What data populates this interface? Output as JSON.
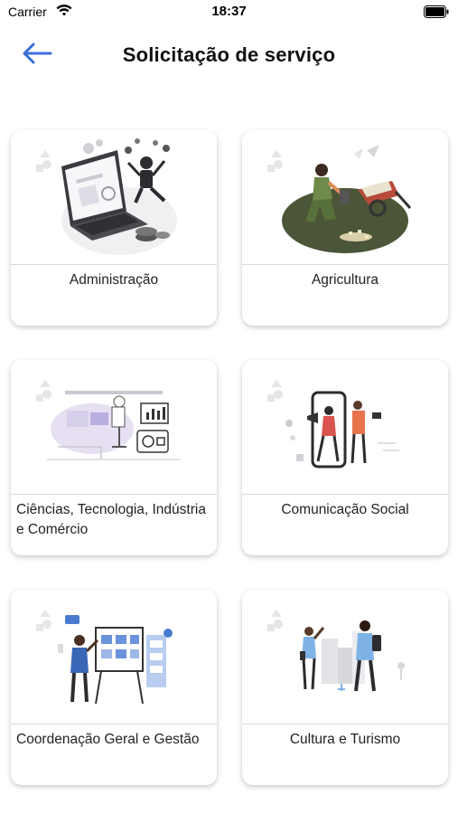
{
  "status_bar": {
    "carrier": "Carrier",
    "time": "18:37"
  },
  "header": {
    "title": "Solicitação de serviço",
    "back_icon": "arrow-left-icon",
    "accent_color": "#3b6fd8"
  },
  "cards": [
    {
      "label": "Administração",
      "illustration": "laptop-dashboard-illustration"
    },
    {
      "label": "Agricultura",
      "illustration": "gardener-wheelbarrow-illustration"
    },
    {
      "label": "Ciências, Tecnologia, Indústria e Comércio",
      "illustration": "robot-factory-illustration"
    },
    {
      "label": "Comunicação Social",
      "illustration": "smartphone-megaphone-illustration"
    },
    {
      "label": "Coordenação Geral e Gestão",
      "illustration": "whiteboard-presentation-illustration"
    },
    {
      "label": "Cultura e Turismo",
      "illustration": "tourists-city-illustration"
    }
  ]
}
